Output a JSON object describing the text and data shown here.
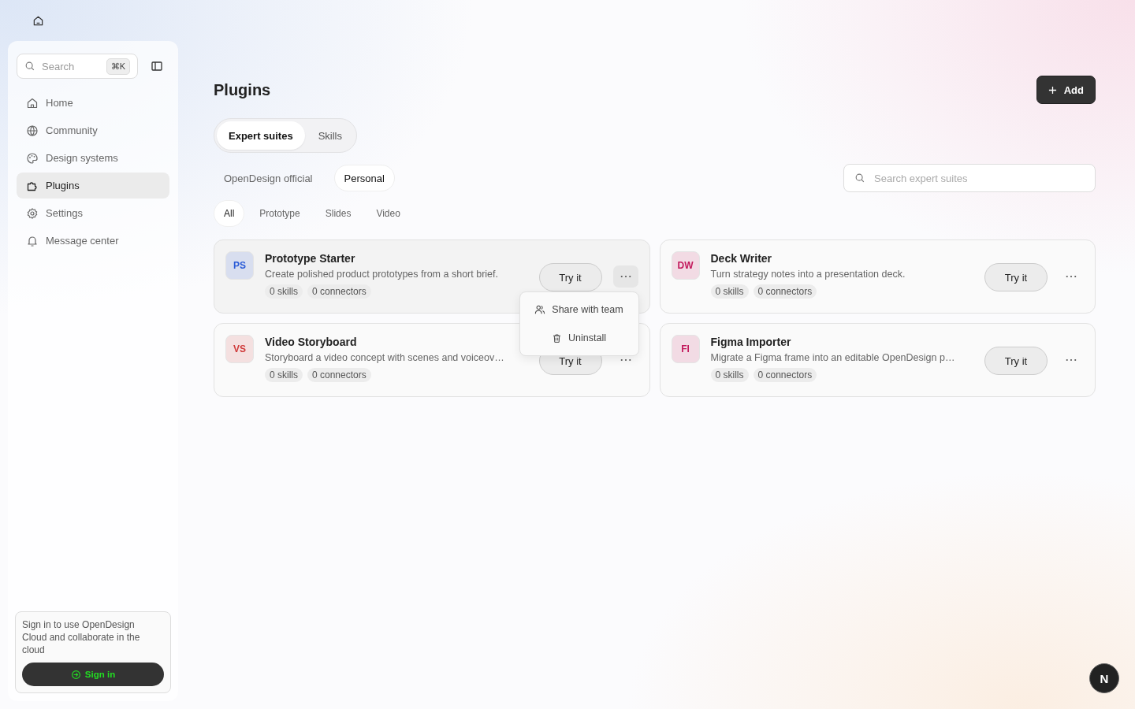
{
  "sidebar": {
    "search": {
      "placeholder": "Search",
      "shortcut": "⌘K"
    },
    "items": [
      {
        "label": "Home",
        "selected": false
      },
      {
        "label": "Community",
        "selected": false
      },
      {
        "label": "Design systems",
        "selected": false
      },
      {
        "label": "Plugins",
        "selected": true
      },
      {
        "label": "Settings",
        "selected": false
      },
      {
        "label": "Message center",
        "selected": false
      }
    ],
    "sign_in_card": {
      "text": "Sign in to use OpenDesign Cloud and collaborate in the cloud",
      "button": "Sign in"
    }
  },
  "page": {
    "title": "Plugins",
    "add_button": "Add",
    "tabs": [
      {
        "label": "Expert suites",
        "selected": true
      },
      {
        "label": "Skills",
        "selected": false
      }
    ],
    "sources": [
      {
        "label": "OpenDesign official",
        "selected": false
      },
      {
        "label": "Personal",
        "selected": true
      }
    ],
    "search": {
      "placeholder": "Search expert suites"
    },
    "categories": [
      {
        "label": "All",
        "selected": true
      },
      {
        "label": "Prototype",
        "selected": false
      },
      {
        "label": "Slides",
        "selected": false
      },
      {
        "label": "Video",
        "selected": false
      }
    ],
    "plugins": [
      {
        "initials": "PS",
        "color": "#2a5bd7",
        "name": "Prototype Starter",
        "description": "Create polished product prototypes from a short brief.",
        "skills": "0 skills",
        "connectors": "0 connectors",
        "button": "Try it",
        "hovered": true,
        "menu": [
          {
            "label": "Share with team"
          },
          {
            "label": "Uninstall"
          }
        ]
      },
      {
        "initials": "DW",
        "color": "#c2185b",
        "name": "Deck Writer",
        "description": "Turn strategy notes into a presentation deck.",
        "skills": "0 skills",
        "connectors": "0 connectors",
        "button": "Try it",
        "hovered": false
      },
      {
        "initials": "VS",
        "color": "#d03a3a",
        "name": "Video Storyboard",
        "description": "Storyboard a video concept with scenes and voiceov…",
        "skills": "0 skills",
        "connectors": "0 connectors",
        "button": "Try it",
        "hovered": false
      },
      {
        "initials": "FI",
        "color": "#c2185b",
        "name": "Figma Importer",
        "description": "Migrate a Figma frame into an editable OpenDesign p…",
        "skills": "0 skills",
        "connectors": "0 connectors",
        "button": "Try it",
        "hovered": false
      }
    ]
  },
  "assistant_badge": "N"
}
